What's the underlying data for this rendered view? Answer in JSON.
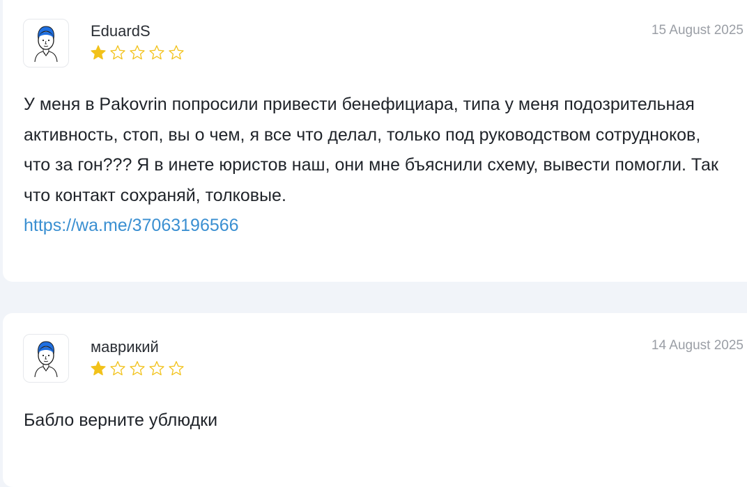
{
  "reviews": [
    {
      "author": "EduardS",
      "date": "15 August 2025",
      "rating": 1,
      "rating_max": 5,
      "text": "У меня в Pakovrin попросили привести бенефициара, типа у меня подозрительная активность, стоп, вы о чем, я все что делал, только под руководством сотрудноков, что за гон??? Я в инете юристов наш, они мне бъяснили схему, вывести помогли. Так что контакт сохраняй, толковые.",
      "link": "https://wa.me/37063196566"
    },
    {
      "author": "маврикий",
      "date": "14 August 2025",
      "rating": 1,
      "rating_max": 5,
      "text": "Бабло верните ублюдки"
    }
  ],
  "colors": {
    "star_filled": "#f2c21a",
    "star_empty": "#f2c21a",
    "link": "#3a8fd1",
    "avatar_hair": "#1f6fe0"
  },
  "icons": {
    "avatar": "user-avatar-icon",
    "star_filled": "star-filled-icon",
    "star_empty": "star-outline-icon"
  }
}
